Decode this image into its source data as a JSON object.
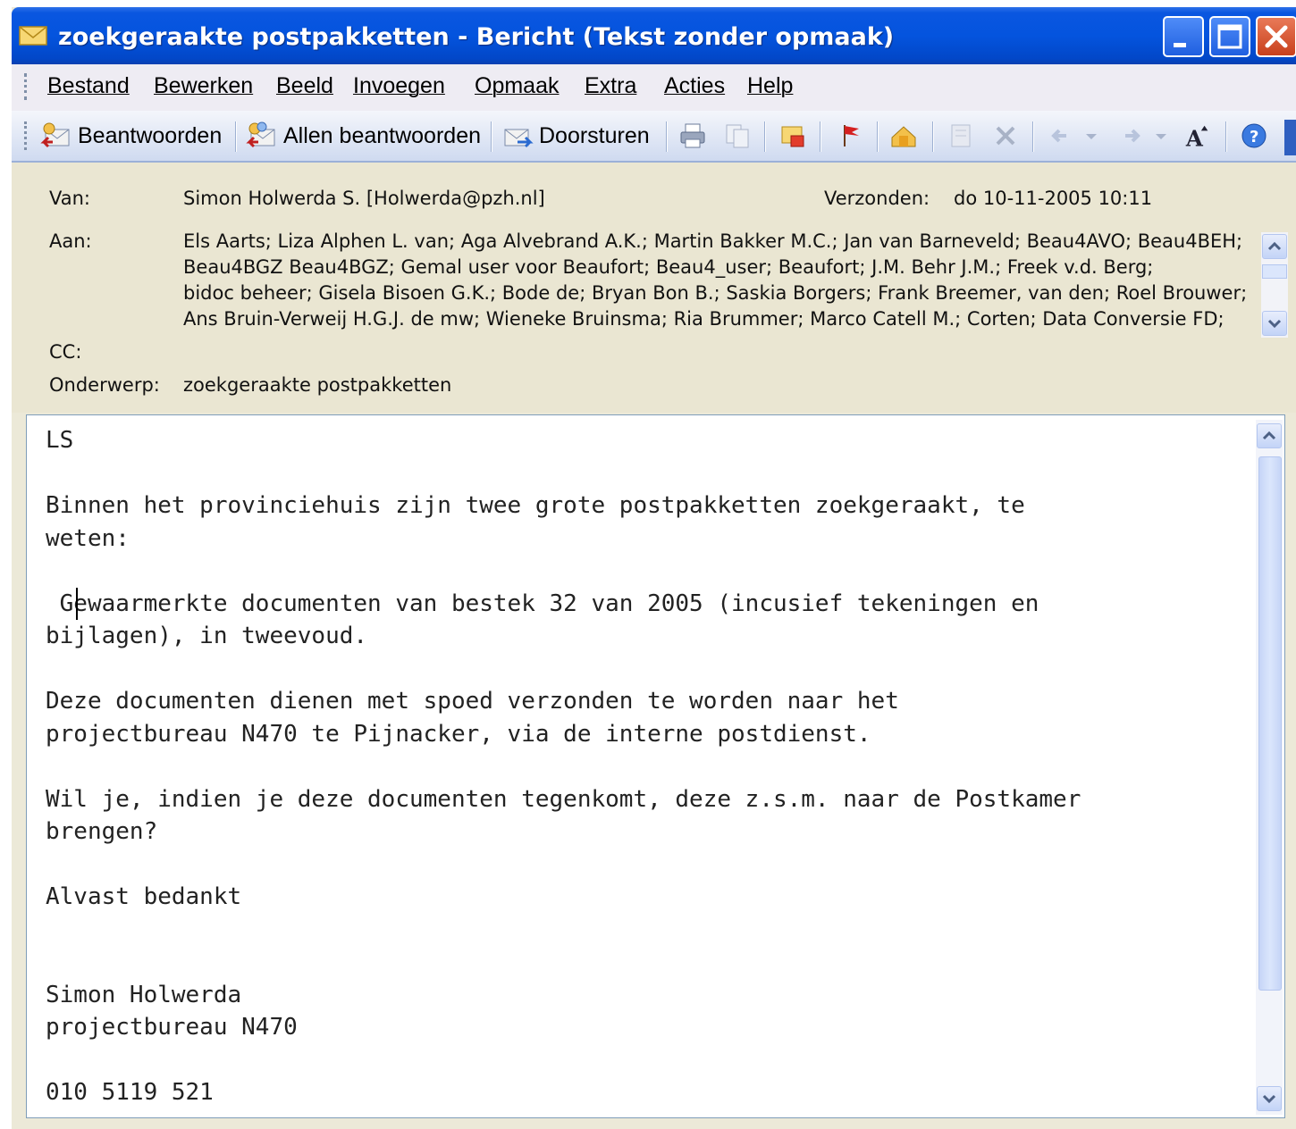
{
  "window": {
    "title": "zoekgeraakte postpakketten - Bericht (Tekst zonder opmaak)"
  },
  "menu": [
    "Bestand",
    "Bewerken",
    "Beeld",
    "Invoegen",
    "Opmaak",
    "Extra",
    "Acties",
    "Help"
  ],
  "toolbar": {
    "reply_label": "Beantwoorden",
    "reply_all_label": "Allen beantwoorden",
    "forward_label": "Doorsturen",
    "icons": [
      "print-icon",
      "copy-icon",
      "move-to-folder-icon",
      "flag-icon",
      "address-book-icon",
      "delete-icon",
      "previous-item-icon",
      "next-item-icon",
      "font-size-icon",
      "help-icon"
    ]
  },
  "header": {
    "from_label": "Van:",
    "from_value": "Simon Holwerda S. [Holwerda@pzh.nl]",
    "sent_label": "Verzonden:",
    "sent_value": "do 10-11-2005 10:11",
    "to_label": "Aan:",
    "to_lines": [
      "Els Aarts; Liza Alphen L. van; Aga Alvebrand A.K.; Martin Bakker M.C.; Jan van Barneveld; Beau4AVO; Beau4BEH;",
      "Beau4BGZ Beau4BGZ; Gemal user voor Beaufort; Beau4_user; Beaufort; J.M. Behr J.M.; Freek v.d. Berg;",
      "bidoc beheer; Gisela Bisoen G.K.; Bode de; Bryan Bon B.; Saskia Borgers; Frank Breemer, van den; Roel Brouwer;",
      "Ans Bruin-Verweij H.G.J. de mw; Wieneke Bruinsma; Ria Brummer; Marco Catell M.; Corten; Data Conversie FD;"
    ],
    "cc_label": "CC:",
    "subject_label": "Onderwerp:",
    "subject_value": "zoekgeraakte postpakketten"
  },
  "body": {
    "text": "LS\n\nBinnen het provinciehuis zijn twee grote postpakketten zoekgeraakt, te\nweten:\n\n Gewaarmerkte documenten van bestek 32 van 2005 (incusief tekeningen en\nbijlagen), in tweevoud.\n\nDeze documenten dienen met spoed verzonden te worden naar het\nprojectbureau N470 te Pijnacker, via de interne postdienst.\n\nWil je, indien je deze documenten tegenkomt, deze z.s.m. naar de Postkamer\nbrengen?\n\nAlvast bedankt\n\n\nSimon Holwerda\nprojectbureau N470\n\n010 5119 521"
  },
  "colors": {
    "titlebar": "#0454de",
    "header_bg": "#eae6d2",
    "close_button": "#c8401c"
  }
}
